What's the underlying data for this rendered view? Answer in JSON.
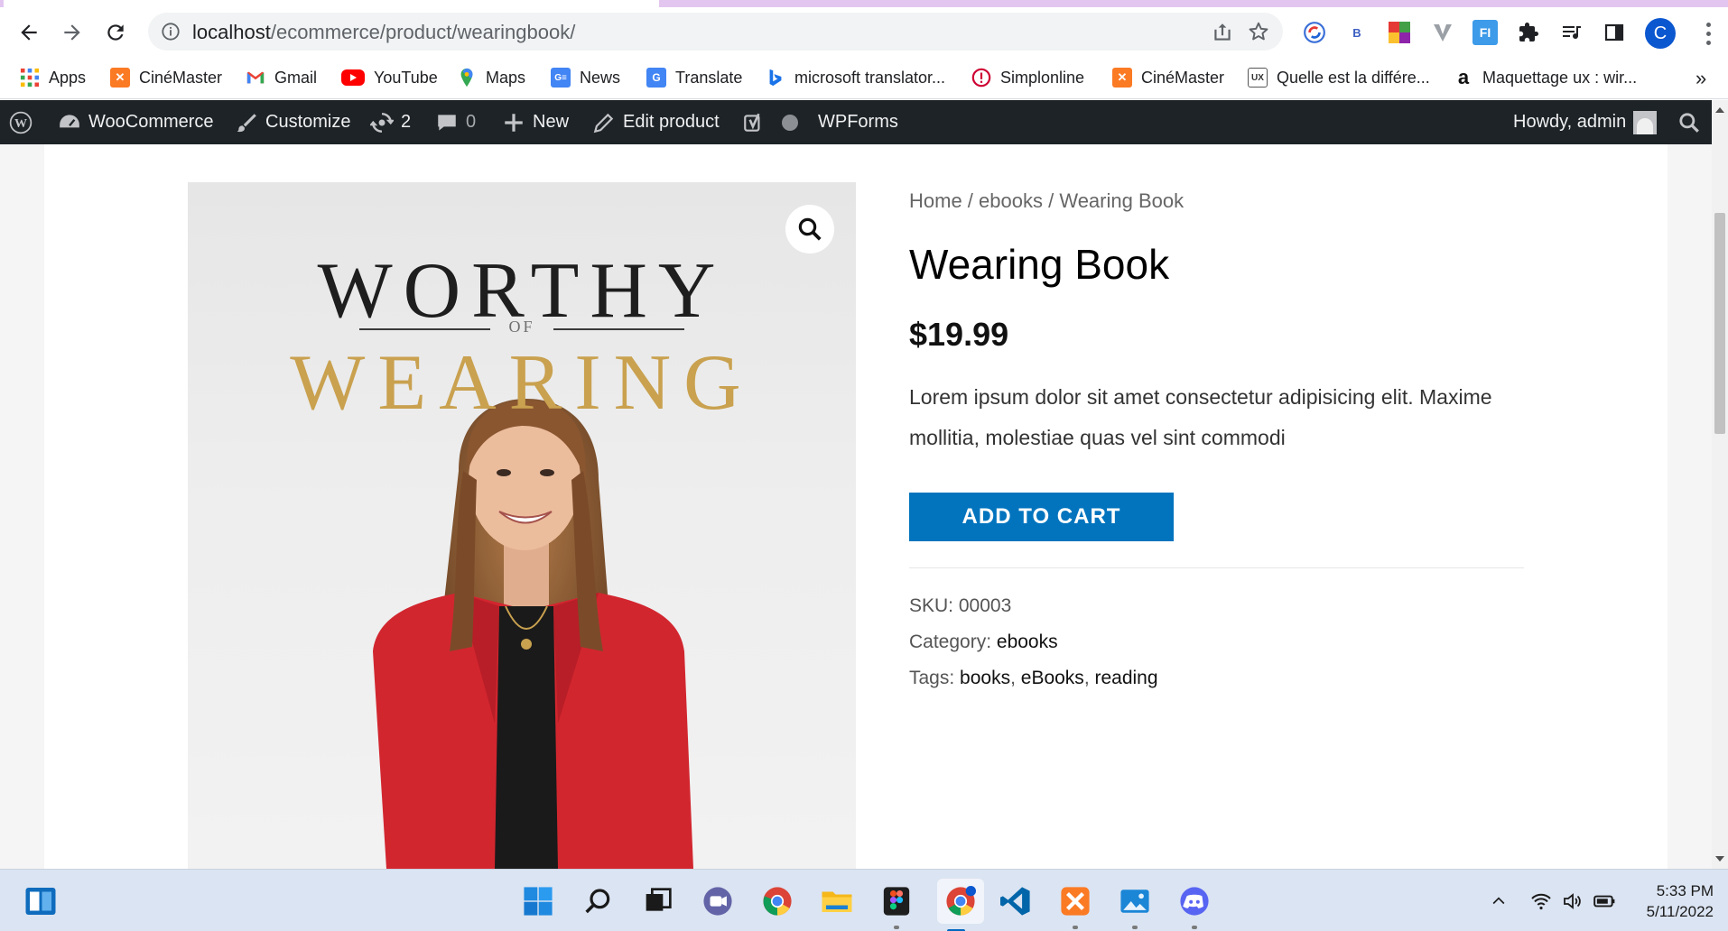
{
  "browser": {
    "url_host": "localhost",
    "url_path": "/ecommerce/product/wearingbook/",
    "profile_initial": "C",
    "extensions": [
      "translator-icon",
      "B",
      "colorful-ext-icon",
      "v-ext-icon",
      "FI",
      "puzzle-icon",
      "media-list-icon",
      "side-panel-icon"
    ]
  },
  "bookmarks": [
    {
      "label": "Apps",
      "icon": "apps-grid-icon"
    },
    {
      "label": "CinéMaster",
      "icon": "xampp-icon"
    },
    {
      "label": "Gmail",
      "icon": "gmail-icon"
    },
    {
      "label": "YouTube",
      "icon": "youtube-icon"
    },
    {
      "label": "Maps",
      "icon": "maps-icon"
    },
    {
      "label": "News",
      "icon": "news-icon"
    },
    {
      "label": "Translate",
      "icon": "translate-icon"
    },
    {
      "label": "microsoft translator...",
      "icon": "bing-icon"
    },
    {
      "label": "Simplonline",
      "icon": "simplon-icon"
    },
    {
      "label": "CinéMaster",
      "icon": "xampp-icon"
    },
    {
      "label": "Quelle est la différe...",
      "icon": "ux-icon"
    },
    {
      "label": "Maquettage ux : wir...",
      "icon": "amazon-icon"
    }
  ],
  "wp_admin_bar": {
    "site_name": "WooCommerce",
    "customize": "Customize",
    "updates_count": "2",
    "comments_count": "0",
    "new_label": "New",
    "edit_label": "Edit product",
    "forms_label": "WPForms",
    "howdy": "Howdy, admin"
  },
  "product": {
    "breadcrumb": {
      "home": "Home",
      "sep1": " / ",
      "category": "ebooks",
      "sep2": " / ",
      "current": "Wearing Book"
    },
    "title": "Wearing Book",
    "price": "$19.99",
    "description": "Lorem ipsum dolor sit amet consectetur adipisicing elit. Maxime mollitia, molestiae quas vel sint commodi",
    "add_to_cart": "ADD TO CART",
    "sku_label": "SKU:",
    "sku": "00003",
    "category_label": "Category:",
    "category": "ebooks",
    "tags_label": "Tags:",
    "tags": [
      "books",
      "eBooks",
      "reading"
    ],
    "cover": {
      "line1": "WORTHY",
      "line2": "OF",
      "line3": "WEARING"
    }
  },
  "taskbar": {
    "time": "5:33 PM",
    "date": "5/11/2022",
    "apps": [
      "widgets-icon",
      "start-icon",
      "search-icon",
      "task-view-icon",
      "teams-icon",
      "chrome-icon",
      "file-explorer-icon",
      "figma-icon",
      "chrome-profile-icon",
      "vscode-icon",
      "xampp-icon",
      "photos-icon",
      "discord-icon"
    ]
  },
  "colors": {
    "wp_bar": "#1d2327",
    "button": "#0274be",
    "cover_gold": "#c9a14f",
    "taskbar": "#dbe4f2"
  }
}
